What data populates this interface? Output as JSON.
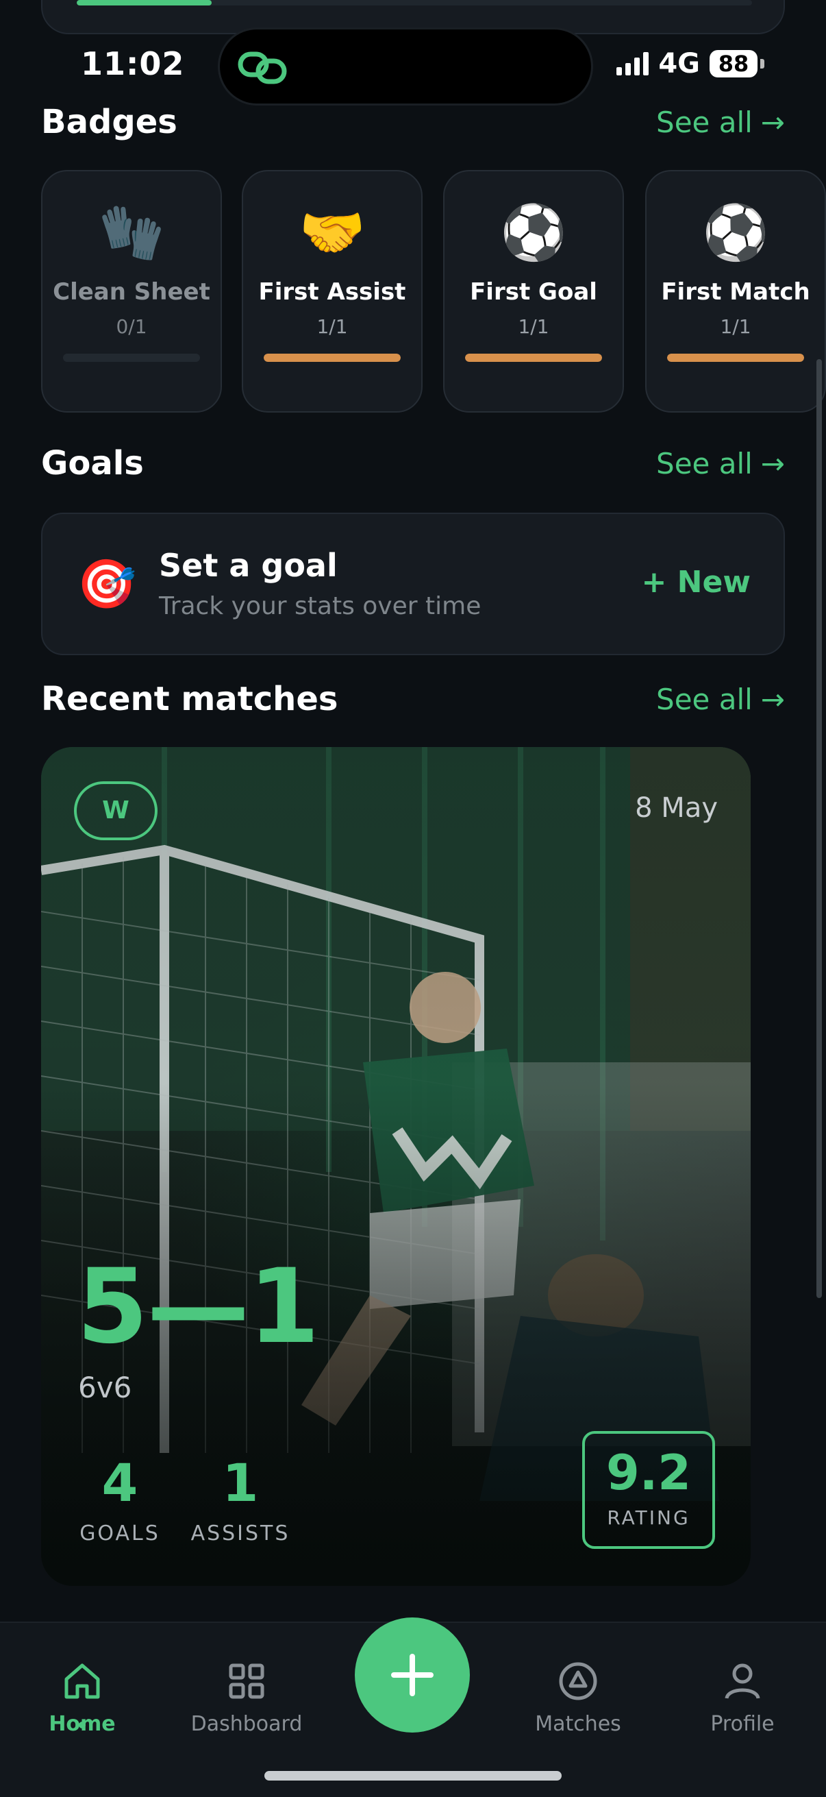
{
  "status_bar": {
    "time": "11:02",
    "network": "4G",
    "battery": "88"
  },
  "top_card": {
    "progress": 0.2
  },
  "badges": {
    "title": "Badges",
    "see_all": "See all",
    "items": [
      {
        "name": "Clean Sheet",
        "count": "0/1",
        "emoji": "🧤",
        "progress": 0,
        "locked": true
      },
      {
        "name": "First Assist",
        "count": "1/1",
        "emoji": "🤝",
        "progress": 1,
        "locked": false
      },
      {
        "name": "First Goal",
        "count": "1/1",
        "emoji": "⚽",
        "progress": 1,
        "locked": false
      },
      {
        "name": "First Match",
        "count": "1/1",
        "emoji": "⚽",
        "progress": 1,
        "locked": false
      }
    ]
  },
  "goals": {
    "title": "Goals",
    "see_all": "See all",
    "card": {
      "icon": "🎯",
      "title": "Set a goal",
      "subtitle": "Track your stats over time",
      "action": "+ New"
    }
  },
  "recent_matches": {
    "title": "Recent matches",
    "see_all": "See all",
    "match": {
      "result": "W",
      "date": "8 May",
      "score": "5—1",
      "format": "6v6",
      "goals_value": "4",
      "goals_label": "GOALS",
      "assists_value": "1",
      "assists_label": "ASSISTS",
      "rating_value": "9.2",
      "rating_label": "RATING"
    }
  },
  "tabbar": {
    "home": "Home",
    "dashboard": "Dashboard",
    "matches": "Matches",
    "profile": "Profile"
  },
  "colors": {
    "background": "#0c1014",
    "accent": "#4cc77f",
    "card": "#161b21",
    "badge_progress": "#d8914c"
  }
}
